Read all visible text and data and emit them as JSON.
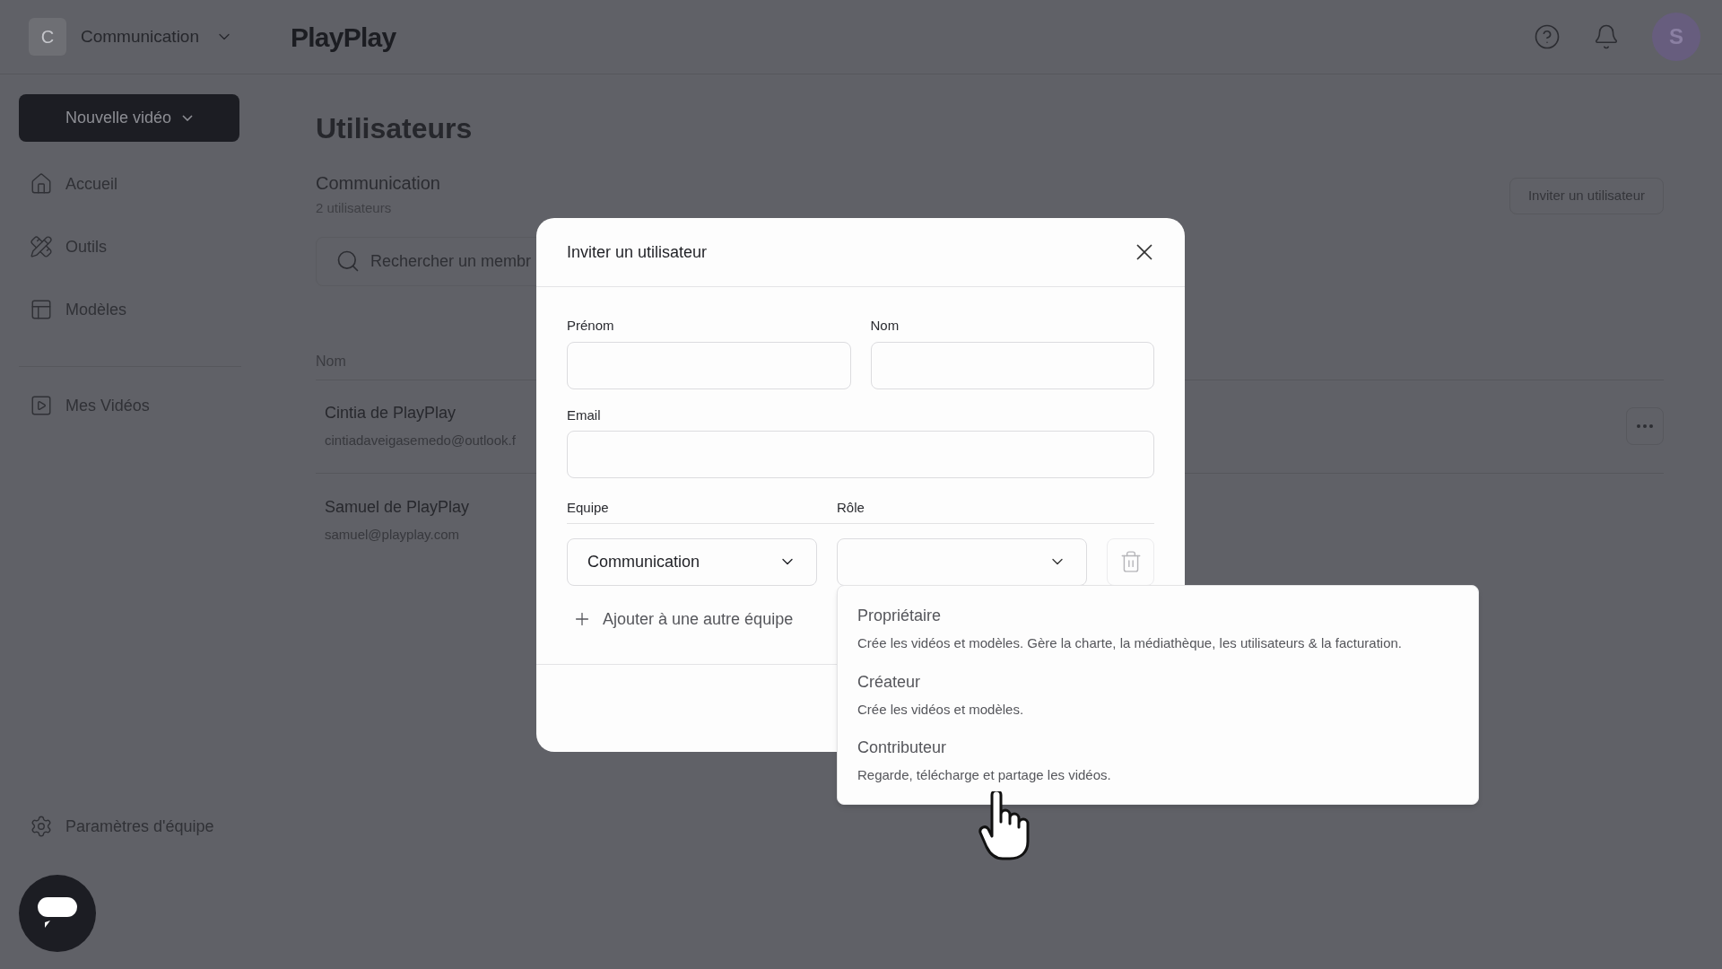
{
  "header": {
    "workspace_initial": "C",
    "workspace": "Communication",
    "logo": "PlayPlay",
    "avatar_initial": "S"
  },
  "sidebar": {
    "new_button": "Nouvelle vidéo",
    "items": [
      {
        "label": "Accueil",
        "kind": "home"
      },
      {
        "label": "Outils",
        "kind": "tools"
      },
      {
        "label": "Modèles",
        "kind": "templates"
      },
      {
        "label": "Mes Vidéos",
        "kind": "videos"
      }
    ],
    "settings": "Paramètres d'équipe"
  },
  "page": {
    "title": "Utilisateurs",
    "team": "Communication",
    "count": "2 utilisateurs",
    "invite_button": "Inviter un utilisateur",
    "search": {
      "placeholder": "Rechercher un membr"
    },
    "table": {
      "columns": [
        "Nom"
      ],
      "rows": [
        {
          "name": "Cintia de PlayPlay",
          "email": "cintiadaveigasemedo@outlook.f",
          "menu": true
        },
        {
          "name": "Samuel de PlayPlay",
          "email": "samuel@playplay.com"
        }
      ]
    }
  },
  "dialog": {
    "title": "Inviter un utilisateur",
    "first_name": {
      "label": "Prénom"
    },
    "last_name": {
      "label": "Nom"
    },
    "email": {
      "label": "Email"
    },
    "team_label": "Equipe",
    "role_label": "Rôle",
    "team_value": "Communication",
    "add_team": "Ajouter à une autre équipe"
  },
  "role_menu": [
    {
      "label": "Propriétaire",
      "description": "Crée les vidéos et modèles. Gère la charte, la médiathèque, les utilisateurs & la facturation."
    },
    {
      "label": "Créateur",
      "description": "Crée les vidéos et modèles."
    },
    {
      "label": "Contributeur",
      "description": "Regarde, télécharge et partage les vidéos."
    }
  ]
}
